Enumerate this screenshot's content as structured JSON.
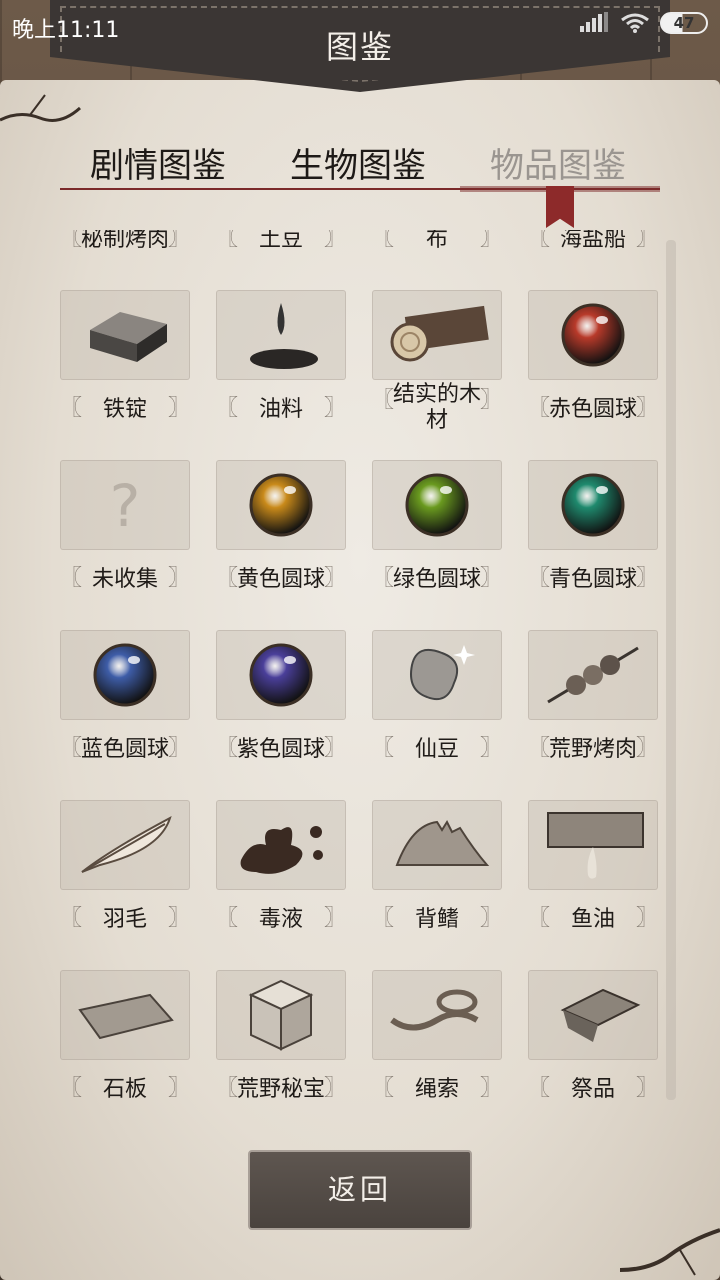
{
  "status_bar": {
    "time": "晚上11:11",
    "battery": "47"
  },
  "header": {
    "title": "图鉴"
  },
  "tabs": [
    {
      "label": "剧情图鉴",
      "active": false
    },
    {
      "label": "生物图鉴",
      "active": false
    },
    {
      "label": "物品图鉴",
      "active": true
    }
  ],
  "items": [
    {
      "name": "秘制烤肉",
      "icon": "partial-hidden"
    },
    {
      "name": "土豆",
      "icon": "partial-hidden"
    },
    {
      "name": "布",
      "icon": "partial-hidden"
    },
    {
      "name": "海盐船",
      "icon": "partial-hidden"
    },
    {
      "name": "铁锭",
      "icon": "iron-ingot-icon"
    },
    {
      "name": "油料",
      "icon": "oil-drop-icon"
    },
    {
      "name": "结实的木材",
      "icon": "wood-log-icon"
    },
    {
      "name": "赤色圆球",
      "icon": "red-orb-icon",
      "color": "#b83a2a"
    },
    {
      "name": "未收集",
      "icon": "question-mark-icon"
    },
    {
      "name": "黄色圆球",
      "icon": "yellow-orb-icon",
      "color": "#c98a1a"
    },
    {
      "name": "绿色圆球",
      "icon": "green-orb-icon",
      "color": "#6a9a1f"
    },
    {
      "name": "青色圆球",
      "icon": "cyan-orb-icon",
      "color": "#1f8a6e"
    },
    {
      "name": "蓝色圆球",
      "icon": "blue-orb-icon",
      "color": "#3e5da8"
    },
    {
      "name": "紫色圆球",
      "icon": "purple-orb-icon",
      "color": "#4a3f9a"
    },
    {
      "name": "仙豆",
      "icon": "bean-icon"
    },
    {
      "name": "荒野烤肉",
      "icon": "skewer-icon"
    },
    {
      "name": "羽毛",
      "icon": "feather-icon"
    },
    {
      "name": "毒液",
      "icon": "venom-splash-icon"
    },
    {
      "name": "背鳍",
      "icon": "fin-icon"
    },
    {
      "name": "鱼油",
      "icon": "fish-oil-icon"
    },
    {
      "name": "石板",
      "icon": "stone-slab-icon"
    },
    {
      "name": "荒野秘宝",
      "icon": "treasure-box-icon"
    },
    {
      "name": "绳索",
      "icon": "rope-icon"
    },
    {
      "name": "祭品",
      "icon": "offering-icon"
    }
  ],
  "back_button": {
    "label": "返回"
  }
}
